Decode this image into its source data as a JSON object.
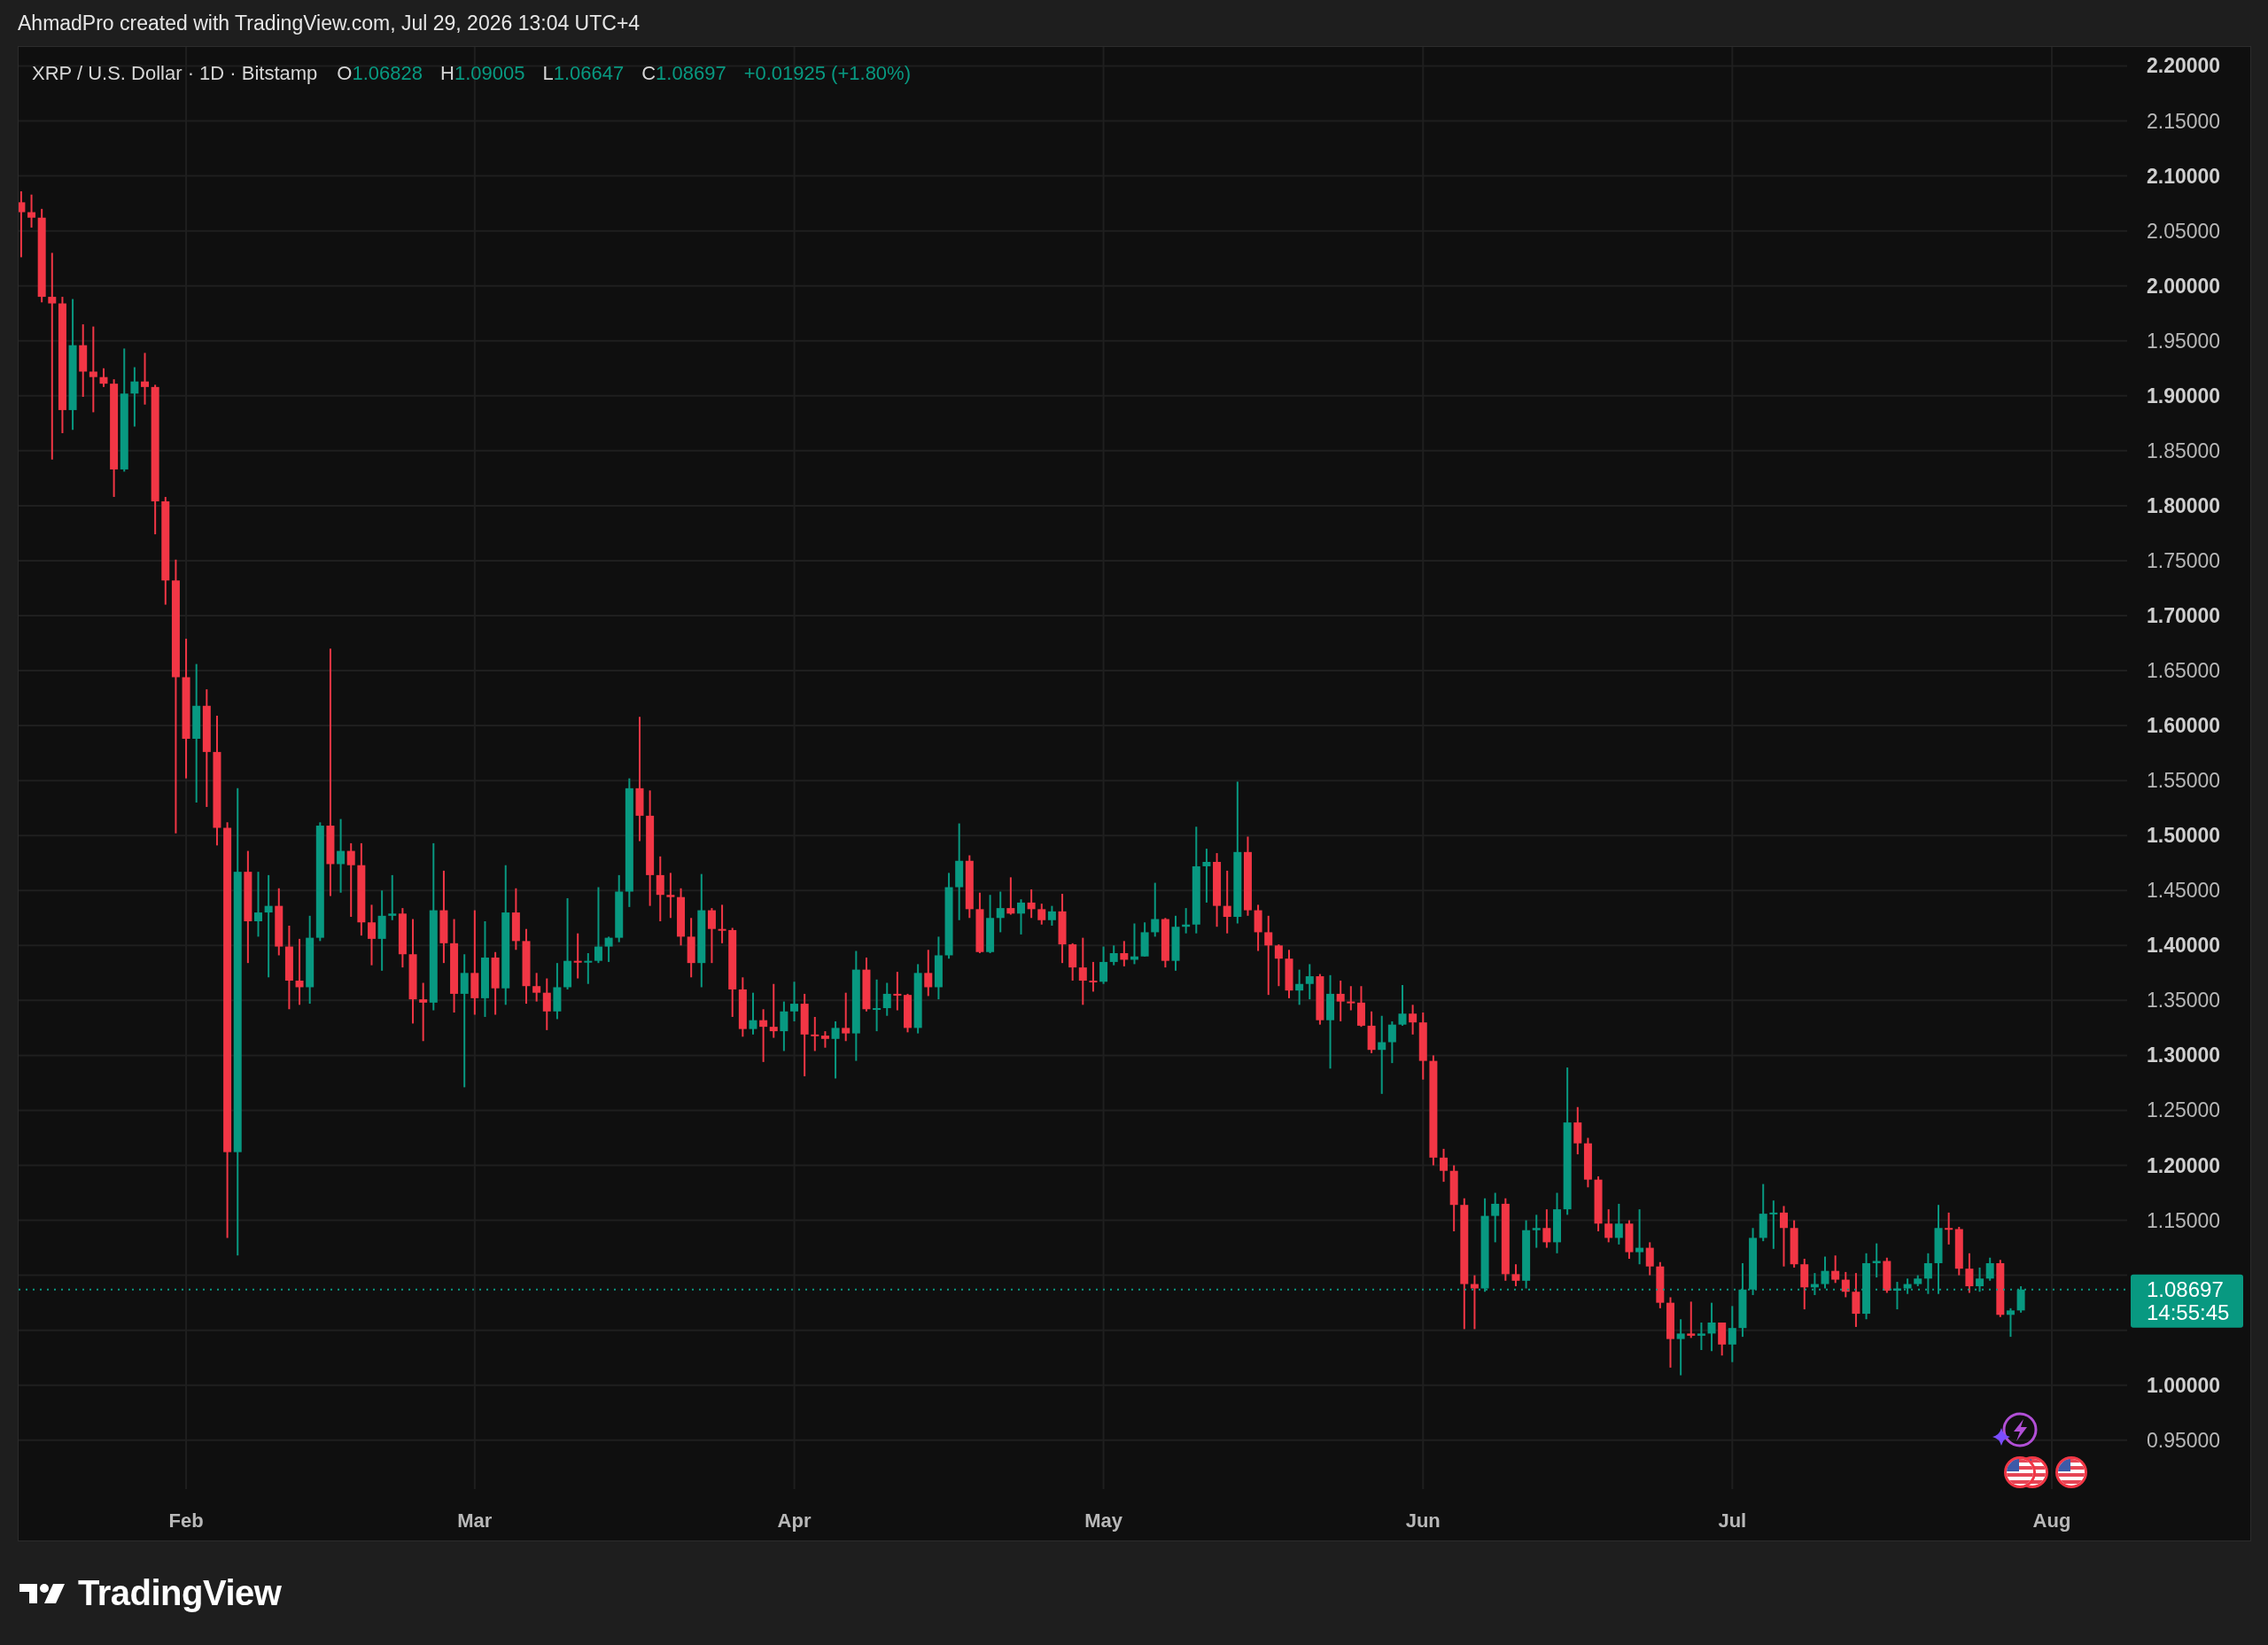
{
  "header": {
    "text": "AhmadPro created with TradingView.com, Jul 29, 2026 13:04 UTC+4"
  },
  "chart": {
    "legend": {
      "symbol": "XRP / U.S. Dollar · 1D · Bitstamp",
      "values": [
        {
          "label": "O",
          "value": "1.06828"
        },
        {
          "label": "H",
          "value": "1.09005"
        },
        {
          "label": "L",
          "value": "1.06647"
        },
        {
          "label": "C",
          "value": "1.08697"
        }
      ],
      "change": "+0.01925 (+1.80%)"
    },
    "last_price": {
      "countdown": "14:55:45"
    },
    "chart_data": {
      "type": "candlestick",
      "grid": true,
      "ylim": [
        0.9055,
        2.2173
      ],
      "ref_lines": [
        {
          "axis": "y",
          "value": 1.08697,
          "label": "1.08697"
        }
      ],
      "categories": [
        null,
        null,
        null,
        null,
        null,
        null,
        null,
        null,
        null,
        null,
        null,
        null,
        null,
        null,
        null,
        null,
        "Feb",
        null,
        null,
        null,
        null,
        null,
        null,
        null,
        null,
        null,
        null,
        null,
        null,
        null,
        null,
        null,
        null,
        null,
        null,
        null,
        null,
        null,
        null,
        null,
        null,
        null,
        null,
        null,
        "Mar",
        null,
        null,
        null,
        null,
        null,
        null,
        null,
        null,
        null,
        null,
        null,
        null,
        null,
        null,
        null,
        null,
        null,
        null,
        null,
        null,
        null,
        null,
        null,
        null,
        null,
        null,
        null,
        null,
        null,
        null,
        "Apr",
        null,
        null,
        null,
        null,
        null,
        null,
        null,
        null,
        null,
        null,
        null,
        null,
        null,
        null,
        null,
        null,
        null,
        null,
        null,
        null,
        null,
        null,
        null,
        null,
        null,
        null,
        null,
        null,
        null,
        "May",
        null,
        null,
        null,
        null,
        null,
        null,
        null,
        null,
        null,
        null,
        null,
        null,
        null,
        null,
        null,
        null,
        null,
        null,
        null,
        null,
        null,
        null,
        null,
        null,
        null,
        null,
        null,
        null,
        null,
        null,
        "Jun",
        null,
        null,
        null,
        null,
        null,
        null,
        null,
        null,
        null,
        null,
        null,
        null,
        null,
        null,
        null,
        null,
        null,
        null,
        null,
        null,
        null,
        null,
        null,
        null,
        null,
        null,
        null,
        null,
        null,
        "Jul",
        null,
        null,
        null,
        null,
        null,
        null,
        null,
        null,
        null,
        null,
        null,
        null,
        null,
        null,
        null,
        null,
        null,
        null,
        null,
        null,
        null,
        null,
        null,
        null,
        null,
        null,
        null,
        null,
        null,
        null,
        "Aug"
      ],
      "yticks": [
        {
          "value": 0.95,
          "label": "0.95000"
        },
        {
          "value": 1.0,
          "label": "1.00000"
        },
        {
          "value": 1.15,
          "label": "1.15000"
        },
        {
          "value": 1.2,
          "label": "1.20000"
        },
        {
          "value": 1.25,
          "label": "1.25000"
        },
        {
          "value": 1.3,
          "label": "1.30000"
        },
        {
          "value": 1.35,
          "label": "1.35000"
        },
        {
          "value": 1.4,
          "label": "1.40000"
        },
        {
          "value": 1.45,
          "label": "1.45000"
        },
        {
          "value": 1.5,
          "label": "1.50000"
        },
        {
          "value": 1.55,
          "label": "1.55000"
        },
        {
          "value": 1.6,
          "label": "1.60000"
        },
        {
          "value": 1.65,
          "label": "1.65000"
        },
        {
          "value": 1.7,
          "label": "1.70000"
        },
        {
          "value": 1.75,
          "label": "1.75000"
        },
        {
          "value": 1.8,
          "label": "1.80000"
        },
        {
          "value": 1.85,
          "label": "1.85000"
        },
        {
          "value": 1.9,
          "label": "1.90000"
        },
        {
          "value": 1.95,
          "label": "1.95000"
        },
        {
          "value": 2.0,
          "label": "2.00000"
        },
        {
          "value": 2.05,
          "label": "2.05000"
        },
        {
          "value": 2.1,
          "label": "2.10000"
        },
        {
          "value": 2.15,
          "label": "2.15000"
        },
        {
          "value": 2.2,
          "label": "2.20000"
        }
      ],
      "ohlc": [
        [
          2.076,
          2.086,
          2.026,
          2.067
        ],
        [
          2.067,
          2.083,
          2.053,
          2.062
        ],
        [
          2.062,
          2.07,
          1.985,
          1.99
        ],
        [
          1.99,
          2.03,
          1.842,
          1.984
        ],
        [
          1.984,
          1.99,
          1.866,
          1.887
        ],
        [
          1.887,
          1.988,
          1.869,
          1.946
        ],
        [
          1.946,
          1.965,
          1.899,
          1.922
        ],
        [
          1.922,
          1.963,
          1.885,
          1.917
        ],
        [
          1.917,
          1.925,
          1.908,
          1.911
        ],
        [
          1.911,
          1.915,
          1.808,
          1.833
        ],
        [
          1.833,
          1.943,
          1.831,
          1.902
        ],
        [
          1.902,
          1.926,
          1.872,
          1.913
        ],
        [
          1.913,
          1.939,
          1.892,
          1.908
        ],
        [
          1.908,
          1.91,
          1.774,
          1.804
        ],
        [
          1.804,
          1.808,
          1.71,
          1.732
        ],
        [
          1.732,
          1.751,
          1.502,
          1.644
        ],
        [
          1.644,
          1.679,
          1.552,
          1.588
        ],
        [
          1.588,
          1.656,
          1.53,
          1.618
        ],
        [
          1.618,
          1.633,
          1.526,
          1.576
        ],
        [
          1.576,
          1.609,
          1.491,
          1.507
        ],
        [
          1.507,
          1.512,
          1.134,
          1.212
        ],
        [
          1.212,
          1.543,
          1.118,
          1.467
        ],
        [
          1.467,
          1.486,
          1.384,
          1.422
        ],
        [
          1.422,
          1.467,
          1.408,
          1.43
        ],
        [
          1.43,
          1.464,
          1.371,
          1.436
        ],
        [
          1.436,
          1.452,
          1.391,
          1.399
        ],
        [
          1.399,
          1.418,
          1.342,
          1.368
        ],
        [
          1.368,
          1.406,
          1.346,
          1.362
        ],
        [
          1.362,
          1.427,
          1.347,
          1.407
        ],
        [
          1.407,
          1.512,
          1.404,
          1.509
        ],
        [
          1.509,
          1.67,
          1.445,
          1.474
        ],
        [
          1.474,
          1.515,
          1.448,
          1.486
        ],
        [
          1.486,
          1.493,
          1.426,
          1.473
        ],
        [
          1.473,
          1.493,
          1.409,
          1.421
        ],
        [
          1.421,
          1.437,
          1.382,
          1.406
        ],
        [
          1.406,
          1.45,
          1.377,
          1.427
        ],
        [
          1.427,
          1.464,
          1.423,
          1.429
        ],
        [
          1.429,
          1.434,
          1.38,
          1.392
        ],
        [
          1.392,
          1.424,
          1.329,
          1.351
        ],
        [
          1.351,
          1.366,
          1.313,
          1.348
        ],
        [
          1.348,
          1.493,
          1.341,
          1.432
        ],
        [
          1.432,
          1.468,
          1.384,
          1.402
        ],
        [
          1.402,
          1.424,
          1.339,
          1.356
        ],
        [
          1.356,
          1.392,
          1.271,
          1.375
        ],
        [
          1.375,
          1.432,
          1.337,
          1.352
        ],
        [
          1.352,
          1.422,
          1.335,
          1.389
        ],
        [
          1.389,
          1.394,
          1.337,
          1.361
        ],
        [
          1.361,
          1.473,
          1.346,
          1.43
        ],
        [
          1.43,
          1.452,
          1.396,
          1.404
        ],
        [
          1.404,
          1.415,
          1.347,
          1.363
        ],
        [
          1.363,
          1.375,
          1.349,
          1.357
        ],
        [
          1.357,
          1.37,
          1.323,
          1.34
        ],
        [
          1.34,
          1.384,
          1.333,
          1.362
        ],
        [
          1.362,
          1.443,
          1.36,
          1.386
        ],
        [
          1.386,
          1.411,
          1.37,
          1.385
        ],
        [
          1.385,
          1.393,
          1.365,
          1.386
        ],
        [
          1.386,
          1.453,
          1.384,
          1.399
        ],
        [
          1.399,
          1.408,
          1.385,
          1.407
        ],
        [
          1.407,
          1.464,
          1.403,
          1.449
        ],
        [
          1.449,
          1.552,
          1.435,
          1.543
        ],
        [
          1.543,
          1.608,
          1.495,
          1.518
        ],
        [
          1.518,
          1.541,
          1.436,
          1.464
        ],
        [
          1.464,
          1.481,
          1.422,
          1.446
        ],
        [
          1.446,
          1.466,
          1.425,
          1.444
        ],
        [
          1.444,
          1.452,
          1.4,
          1.408
        ],
        [
          1.408,
          1.425,
          1.371,
          1.384
        ],
        [
          1.384,
          1.465,
          1.362,
          1.432
        ],
        [
          1.432,
          1.434,
          1.384,
          1.415
        ],
        [
          1.415,
          1.437,
          1.402,
          1.414
        ],
        [
          1.414,
          1.416,
          1.335,
          1.36
        ],
        [
          1.36,
          1.371,
          1.317,
          1.324
        ],
        [
          1.324,
          1.357,
          1.319,
          1.332
        ],
        [
          1.332,
          1.342,
          1.294,
          1.326
        ],
        [
          1.326,
          1.365,
          1.316,
          1.322
        ],
        [
          1.322,
          1.349,
          1.304,
          1.34
        ],
        [
          1.34,
          1.367,
          1.331,
          1.347
        ],
        [
          1.347,
          1.356,
          1.281,
          1.319
        ],
        [
          1.319,
          1.335,
          1.304,
          1.318
        ],
        [
          1.318,
          1.322,
          1.307,
          1.315
        ],
        [
          1.315,
          1.331,
          1.279,
          1.325
        ],
        [
          1.325,
          1.357,
          1.313,
          1.32
        ],
        [
          1.32,
          1.395,
          1.295,
          1.378
        ],
        [
          1.378,
          1.389,
          1.34,
          1.342
        ],
        [
          1.342,
          1.369,
          1.322,
          1.343
        ],
        [
          1.343,
          1.366,
          1.336,
          1.356
        ],
        [
          1.356,
          1.376,
          1.341,
          1.355
        ],
        [
          1.355,
          1.356,
          1.321,
          1.325
        ],
        [
          1.325,
          1.383,
          1.32,
          1.375
        ],
        [
          1.375,
          1.396,
          1.354,
          1.362
        ],
        [
          1.362,
          1.408,
          1.351,
          1.391
        ],
        [
          1.391,
          1.466,
          1.388,
          1.453
        ],
        [
          1.453,
          1.511,
          1.423,
          1.477
        ],
        [
          1.477,
          1.482,
          1.425,
          1.433
        ],
        [
          1.433,
          1.448,
          1.393,
          1.394
        ],
        [
          1.394,
          1.446,
          1.393,
          1.425
        ],
        [
          1.425,
          1.449,
          1.412,
          1.434
        ],
        [
          1.434,
          1.462,
          1.428,
          1.429
        ],
        [
          1.429,
          1.442,
          1.41,
          1.439
        ],
        [
          1.439,
          1.451,
          1.425,
          1.433
        ],
        [
          1.433,
          1.438,
          1.419,
          1.423
        ],
        [
          1.423,
          1.436,
          1.418,
          1.431
        ],
        [
          1.431,
          1.447,
          1.384,
          1.401
        ],
        [
          1.401,
          1.402,
          1.368,
          1.38
        ],
        [
          1.38,
          1.407,
          1.346,
          1.368
        ],
        [
          1.368,
          1.385,
          1.358,
          1.367
        ],
        [
          1.367,
          1.399,
          1.365,
          1.385
        ],
        [
          1.385,
          1.4,
          1.382,
          1.393
        ],
        [
          1.393,
          1.404,
          1.381,
          1.387
        ],
        [
          1.387,
          1.42,
          1.383,
          1.39
        ],
        [
          1.39,
          1.421,
          1.39,
          1.412
        ],
        [
          1.412,
          1.457,
          1.408,
          1.424
        ],
        [
          1.424,
          1.425,
          1.38,
          1.386
        ],
        [
          1.386,
          1.427,
          1.377,
          1.417
        ],
        [
          1.417,
          1.434,
          1.411,
          1.419
        ],
        [
          1.419,
          1.508,
          1.411,
          1.472
        ],
        [
          1.472,
          1.488,
          1.439,
          1.476
        ],
        [
          1.476,
          1.484,
          1.417,
          1.436
        ],
        [
          1.436,
          1.468,
          1.411,
          1.426
        ],
        [
          1.426,
          1.549,
          1.42,
          1.485
        ],
        [
          1.485,
          1.499,
          1.427,
          1.432
        ],
        [
          1.432,
          1.437,
          1.395,
          1.412
        ],
        [
          1.412,
          1.427,
          1.355,
          1.4
        ],
        [
          1.4,
          1.401,
          1.363,
          1.388
        ],
        [
          1.388,
          1.396,
          1.352,
          1.359
        ],
        [
          1.359,
          1.378,
          1.346,
          1.365
        ],
        [
          1.365,
          1.383,
          1.351,
          1.372
        ],
        [
          1.372,
          1.374,
          1.328,
          1.332
        ],
        [
          1.332,
          1.373,
          1.288,
          1.356
        ],
        [
          1.356,
          1.368,
          1.331,
          1.349
        ],
        [
          1.349,
          1.363,
          1.341,
          1.348
        ],
        [
          1.348,
          1.363,
          1.326,
          1.327
        ],
        [
          1.327,
          1.34,
          1.302,
          1.305
        ],
        [
          1.305,
          1.336,
          1.265,
          1.312
        ],
        [
          1.312,
          1.331,
          1.293,
          1.328
        ],
        [
          1.328,
          1.364,
          1.327,
          1.338
        ],
        [
          1.338,
          1.346,
          1.319,
          1.33
        ],
        [
          1.33,
          1.339,
          1.278,
          1.295
        ],
        [
          1.295,
          1.3,
          1.2,
          1.207
        ],
        [
          1.207,
          1.215,
          1.185,
          1.195
        ],
        [
          1.195,
          1.2,
          1.14,
          1.164
        ],
        [
          1.164,
          1.17,
          1.051,
          1.092
        ],
        [
          1.092,
          1.1,
          1.051,
          1.088
        ],
        [
          1.088,
          1.17,
          1.085,
          1.154
        ],
        [
          1.154,
          1.175,
          1.13,
          1.165
        ],
        [
          1.165,
          1.17,
          1.095,
          1.101
        ],
        [
          1.101,
          1.11,
          1.09,
          1.095
        ],
        [
          1.095,
          1.15,
          1.088,
          1.141
        ],
        [
          1.141,
          1.155,
          1.125,
          1.143
        ],
        [
          1.143,
          1.16,
          1.125,
          1.13
        ],
        [
          1.13,
          1.175,
          1.12,
          1.16
        ],
        [
          1.16,
          1.289,
          1.155,
          1.239
        ],
        [
          1.239,
          1.253,
          1.21,
          1.22
        ],
        [
          1.22,
          1.225,
          1.18,
          1.187
        ],
        [
          1.187,
          1.19,
          1.14,
          1.147
        ],
        [
          1.147,
          1.16,
          1.13,
          1.134
        ],
        [
          1.134,
          1.165,
          1.128,
          1.147
        ],
        [
          1.147,
          1.15,
          1.115,
          1.121
        ],
        [
          1.121,
          1.16,
          1.11,
          1.125
        ],
        [
          1.125,
          1.13,
          1.1,
          1.108
        ],
        [
          1.108,
          1.112,
          1.07,
          1.075
        ],
        [
          1.075,
          1.08,
          1.016,
          1.042
        ],
        [
          1.042,
          1.06,
          1.009,
          1.047
        ],
        [
          1.047,
          1.076,
          1.043,
          1.045
        ],
        [
          1.045,
          1.057,
          1.032,
          1.047
        ],
        [
          1.047,
          1.075,
          1.031,
          1.057
        ],
        [
          1.057,
          1.057,
          1.027,
          1.037
        ],
        [
          1.037,
          1.072,
          1.021,
          1.052
        ],
        [
          1.052,
          1.111,
          1.044,
          1.087
        ],
        [
          1.087,
          1.143,
          1.082,
          1.134
        ],
        [
          1.134,
          1.183,
          1.131,
          1.156
        ],
        [
          1.156,
          1.168,
          1.124,
          1.157
        ],
        [
          1.157,
          1.163,
          1.108,
          1.143
        ],
        [
          1.143,
          1.15,
          1.107,
          1.11
        ],
        [
          1.11,
          1.115,
          1.069,
          1.089
        ],
        [
          1.089,
          1.102,
          1.082,
          1.092
        ],
        [
          1.092,
          1.117,
          1.088,
          1.104
        ],
        [
          1.104,
          1.118,
          1.093,
          1.096
        ],
        [
          1.096,
          1.103,
          1.08,
          1.085
        ],
        [
          1.085,
          1.102,
          1.053,
          1.065
        ],
        [
          1.065,
          1.12,
          1.06,
          1.111
        ],
        [
          1.111,
          1.129,
          1.098,
          1.113
        ],
        [
          1.113,
          1.116,
          1.084,
          1.086
        ],
        [
          1.086,
          1.094,
          1.069,
          1.088
        ],
        [
          1.088,
          1.097,
          1.083,
          1.092
        ],
        [
          1.092,
          1.1,
          1.09,
          1.097
        ],
        [
          1.097,
          1.12,
          1.083,
          1.111
        ],
        [
          1.111,
          1.164,
          1.083,
          1.143
        ],
        [
          1.143,
          1.157,
          1.128,
          1.142
        ],
        [
          1.142,
          1.144,
          1.1,
          1.106
        ],
        [
          1.106,
          1.12,
          1.084,
          1.09
        ],
        [
          1.09,
          1.107,
          1.085,
          1.097
        ],
        [
          1.097,
          1.116,
          1.095,
          1.111
        ],
        [
          1.111,
          1.114,
          1.062,
          1.064
        ],
        [
          1.064,
          1.07,
          1.044,
          1.068
        ],
        [
          1.068,
          1.09,
          1.066,
          1.087
        ],
        null,
        null,
        null
      ]
    }
  },
  "footer": {
    "logo_text": "TradingView"
  }
}
